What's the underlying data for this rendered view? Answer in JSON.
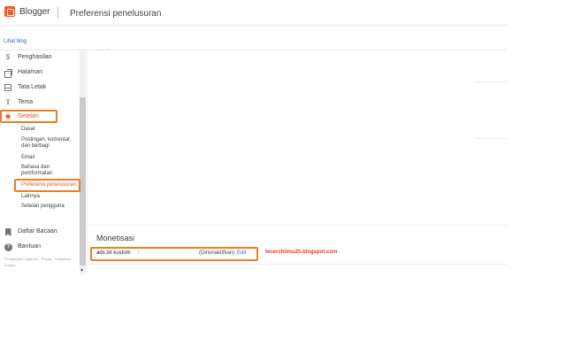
{
  "header": {
    "brand": "Blogger",
    "page_title": "Preferensi penelusuran"
  },
  "subbar": {
    "view_blog": "Lihat blog"
  },
  "sidebar": {
    "items": [
      {
        "label": "Penghasilan",
        "icon": "dollar-icon"
      },
      {
        "label": "Halaman",
        "icon": "pages-icon"
      },
      {
        "label": "Tata Letak",
        "icon": "layout-icon"
      },
      {
        "label": "Tema",
        "icon": "theme-icon"
      },
      {
        "label": "Setelan",
        "icon": "gear-icon"
      }
    ],
    "sub_items": [
      "Dasar",
      "Postingan, komentar, dan berbagi",
      "Email",
      "Bahasa dan pemformatan",
      "Preferensi penelusuran",
      "Lainnya",
      "Setelan pengguna"
    ],
    "bottom_items": [
      {
        "label": "Daftar Bacaan",
        "icon": "bookmark-icon"
      },
      {
        "label": "Bantuan",
        "icon": "help-icon"
      }
    ],
    "footer": "Persyaratan Layanan  ·  Privasi  ·  Kebijakan Konten"
  },
  "main": {
    "cut_text": "· · ·",
    "section_title": "Monetisasi",
    "row": {
      "label": "ads.txt kustom",
      "help": "?",
      "status": "(Dinonaktifkan)",
      "edit": "Edit"
    }
  },
  "watermark": "tecerchilmu25.blogspot.com",
  "colors": {
    "accent": "#ff5722",
    "highlight": "#ee7d23",
    "link": "#3367d6"
  }
}
